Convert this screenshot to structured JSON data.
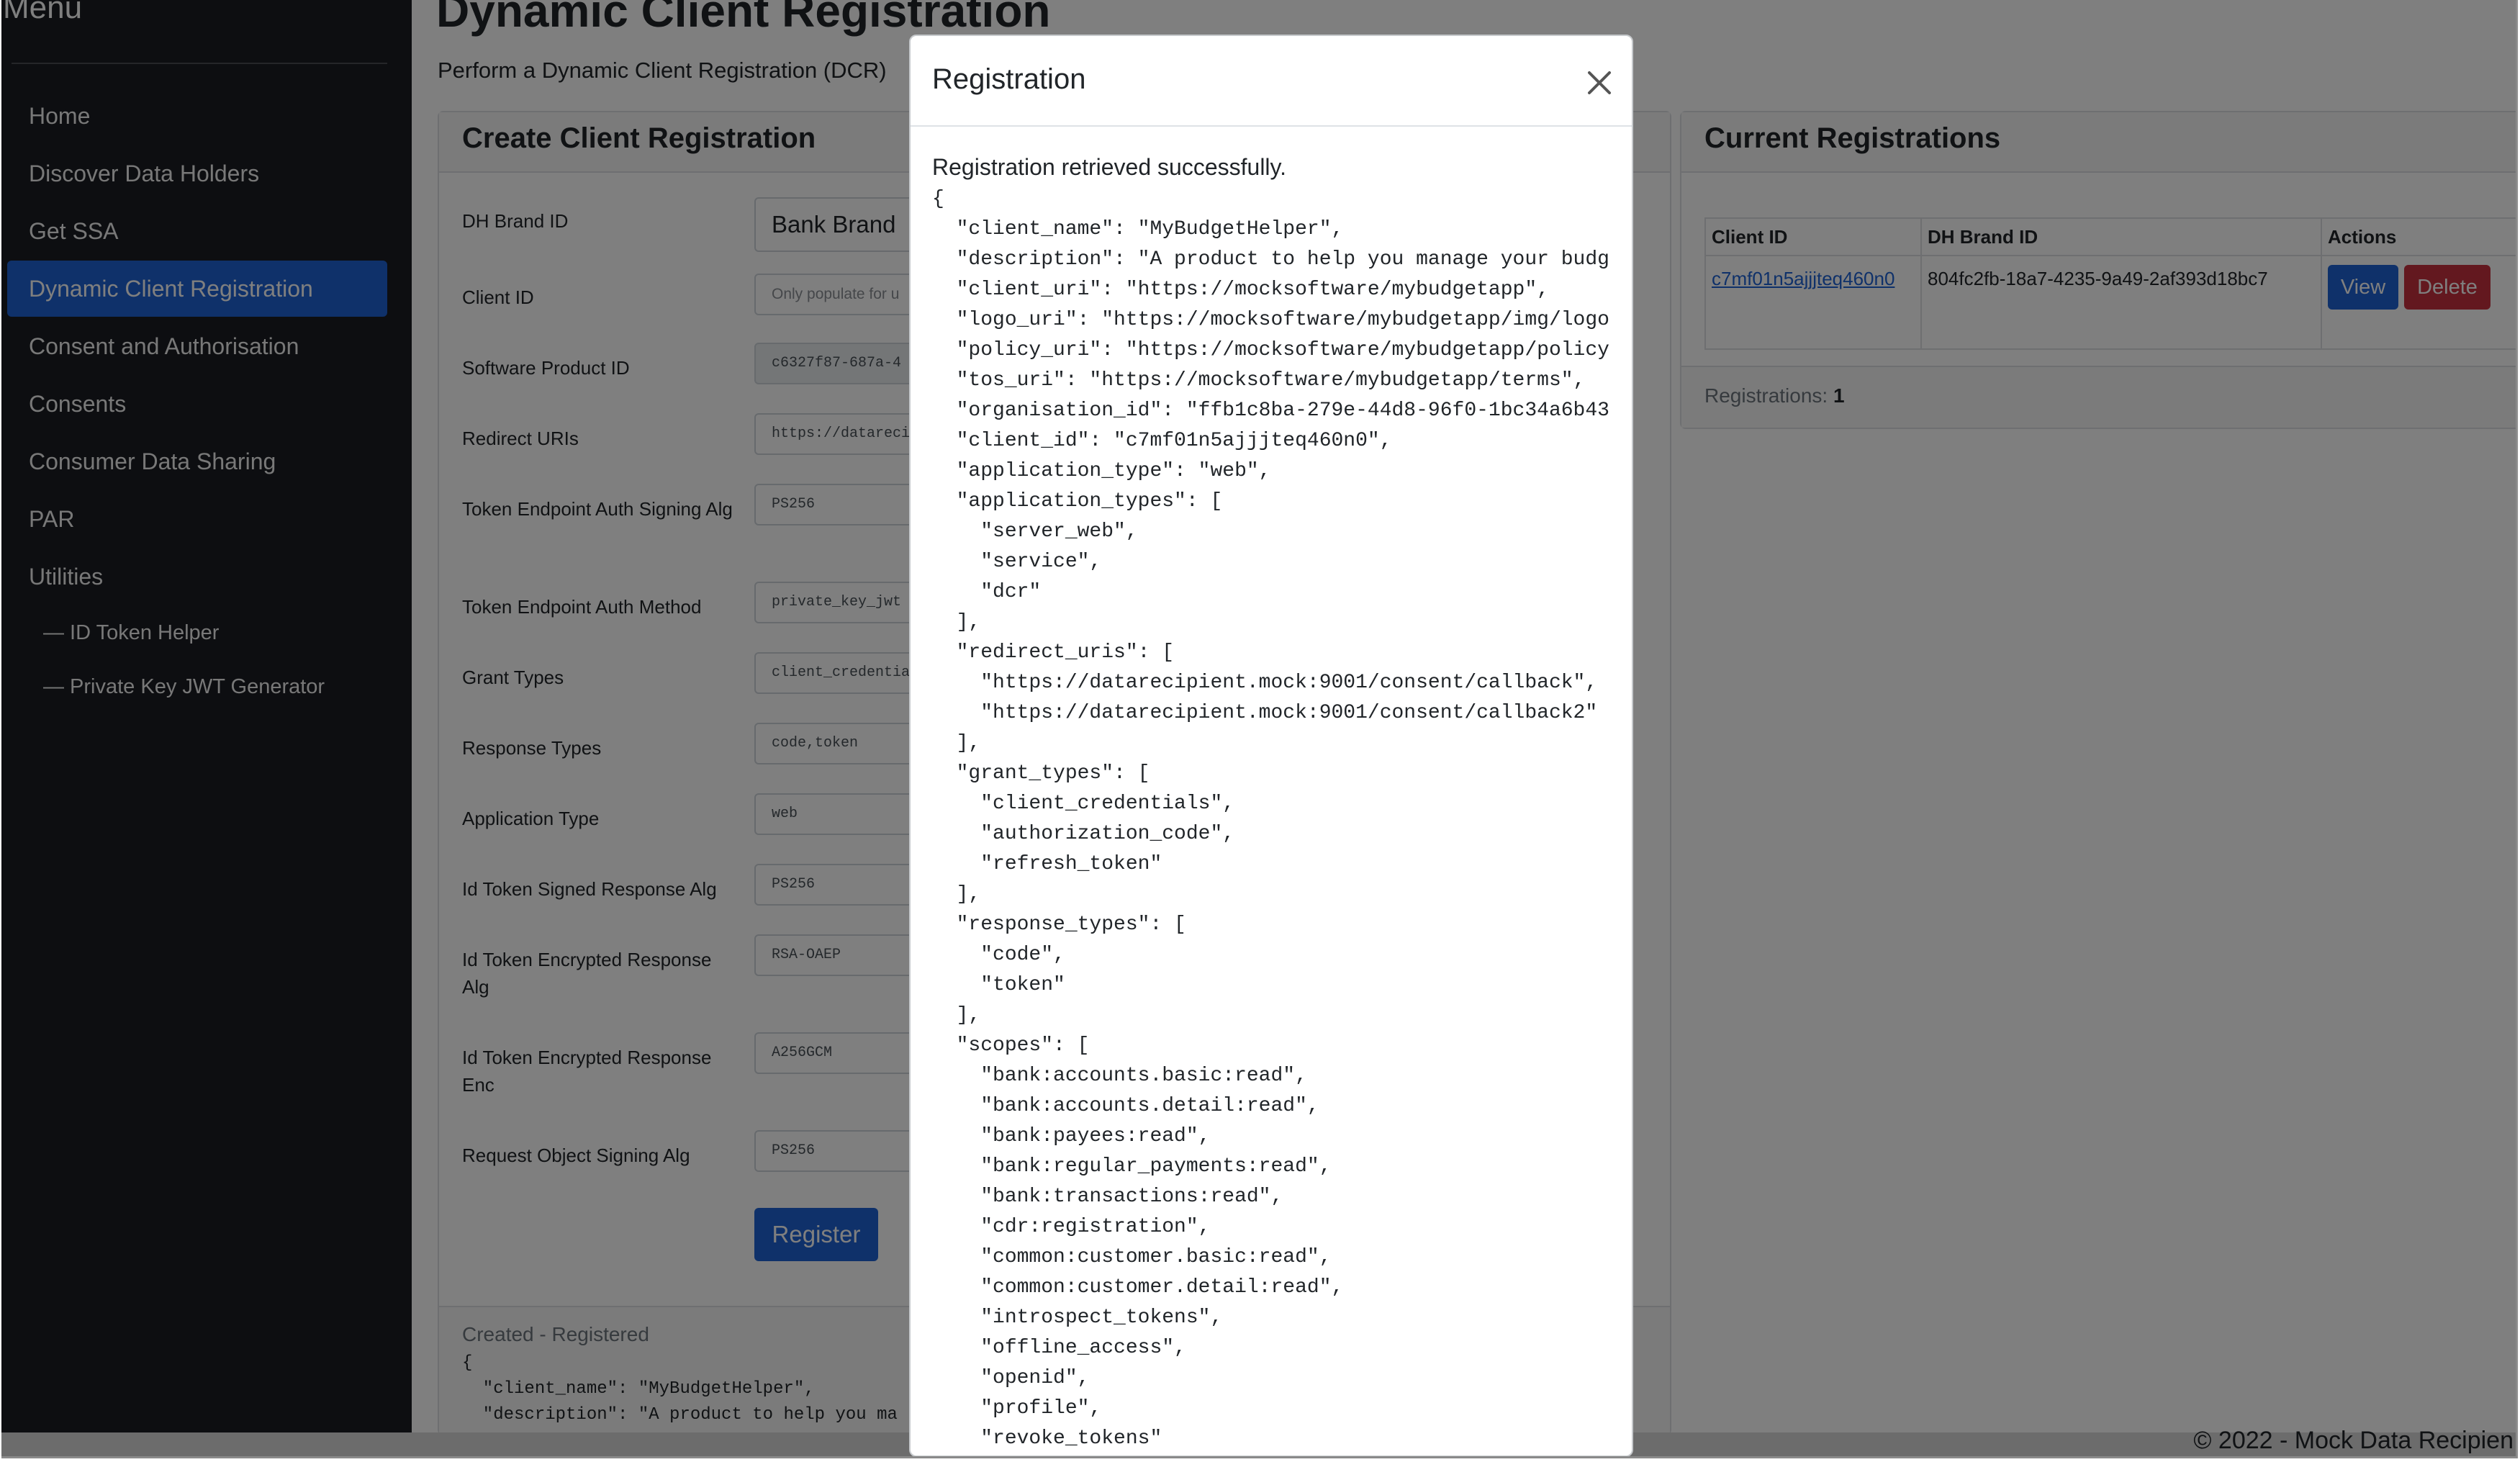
{
  "sidebar": {
    "title": "Menu",
    "items": [
      {
        "label": "Home"
      },
      {
        "label": "Discover Data Holders"
      },
      {
        "label": "Get SSA"
      },
      {
        "label": "Dynamic Client Registration"
      },
      {
        "label": "Consent and Authorisation"
      },
      {
        "label": "Consents"
      },
      {
        "label": "Consumer Data Sharing"
      },
      {
        "label": "PAR"
      },
      {
        "label": "Utilities"
      },
      {
        "label": "— ID Token Helper"
      },
      {
        "label": "— Private Key JWT Generator"
      }
    ],
    "active_item": "Dynamic Client Registration"
  },
  "page": {
    "title": "Dynamic Client Registration",
    "subtitle": "Perform a Dynamic Client Registration (DCR)"
  },
  "create_card": {
    "title": "Create Client Registration",
    "fields": [
      {
        "label": "DH Brand ID",
        "value": "Bank Brand"
      },
      {
        "label": "Client ID",
        "placeholder": "Only populate for u"
      },
      {
        "label": "Software Product ID",
        "value": "c6327f87-687a-4"
      },
      {
        "label": "Redirect URIs",
        "value": "https://datarecipie"
      },
      {
        "label": "Token Endpoint Auth Signing Alg",
        "value": "PS256"
      },
      {
        "label": "Token Endpoint Auth Method",
        "value": "private_key_jwt"
      },
      {
        "label": "Grant Types",
        "value": "client_credentials,"
      },
      {
        "label": "Response Types",
        "value": "code,token"
      },
      {
        "label": "Application Type",
        "value": "web"
      },
      {
        "label": "Id Token Signed Response Alg",
        "value": "PS256"
      },
      {
        "label": "Id Token Encrypted Response Alg",
        "value": "RSA-OAEP"
      },
      {
        "label": "Id Token Encrypted Response Enc",
        "value": "A256GCM"
      },
      {
        "label": "Request Object Signing Alg",
        "value": "PS256"
      }
    ],
    "register_button": "Register",
    "result_status": "Created - Registered",
    "result_snippet": "{\n  \"client_name\": \"MyBudgetHelper\",\n  \"description\": \"A product to help you ma"
  },
  "registrations_card": {
    "title": "Current Registrations",
    "columns": [
      "Client ID",
      "DH Brand ID",
      "Actions"
    ],
    "rows": [
      {
        "client_id": "c7mf01n5ajjjteq460n0",
        "dh_brand_id": "804fc2fb-18a7-4235-9a49-2af393d18bc7",
        "view": "View",
        "delete": "Delete"
      }
    ],
    "footer_label": "Registrations:",
    "footer_count": "1"
  },
  "footer": {
    "copyright": "© 2022 - Mock Data Recipien"
  },
  "modal": {
    "title": "Registration",
    "close_icon": "close-icon",
    "status": "Registration retrieved successfully.",
    "json_text": "{\n  \"client_name\": \"MyBudgetHelper\",\n  \"description\": \"A product to help you manage your budg\n  \"client_uri\": \"https://mocksoftware/mybudgetapp\",\n  \"logo_uri\": \"https://mocksoftware/mybudgetapp/img/logo\n  \"policy_uri\": \"https://mocksoftware/mybudgetapp/policy\n  \"tos_uri\": \"https://mocksoftware/mybudgetapp/terms\",\n  \"organisation_id\": \"ffb1c8ba-279e-44d8-96f0-1bc34a6b43\n  \"client_id\": \"c7mf01n5ajjjteq460n0\",\n  \"application_type\": \"web\",\n  \"application_types\": [\n    \"server_web\",\n    \"service\",\n    \"dcr\"\n  ],\n  \"redirect_uris\": [\n    \"https://datarecipient.mock:9001/consent/callback\",\n    \"https://datarecipient.mock:9001/consent/callback2\"\n  ],\n  \"grant_types\": [\n    \"client_credentials\",\n    \"authorization_code\",\n    \"refresh_token\"\n  ],\n  \"response_types\": [\n    \"code\",\n    \"token\"\n  ],\n  \"scopes\": [\n    \"bank:accounts.basic:read\",\n    \"bank:accounts.detail:read\",\n    \"bank:payees:read\",\n    \"bank:regular_payments:read\",\n    \"bank:transactions:read\",\n    \"cdr:registration\",\n    \"common:customer.basic:read\",\n    \"common:customer.detail:read\",\n    \"introspect_tokens\",\n    \"offline_access\",\n    \"openid\",\n    \"profile\",\n    \"revoke_tokens\""
  }
}
